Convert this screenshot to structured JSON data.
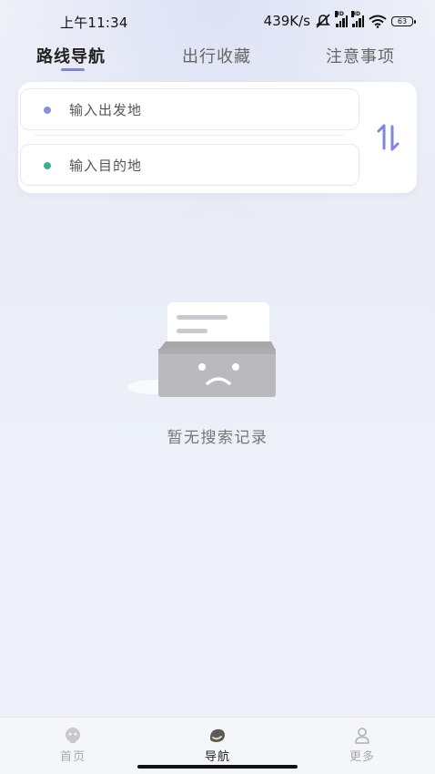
{
  "status_bar": {
    "time": "上午11:34",
    "network_speed": "439K/s",
    "signal_badge_1": "HD",
    "signal_badge_2": "HD",
    "battery": "63"
  },
  "tabs": [
    {
      "label": "路线导航",
      "active": true
    },
    {
      "label": "出行收藏",
      "active": false
    },
    {
      "label": "注意事项",
      "active": false
    }
  ],
  "route": {
    "origin_placeholder": "输入出发地",
    "destination_placeholder": "输入目的地",
    "origin_dot_color": "#8a8fd8",
    "destination_dot_color": "#3cae8f",
    "swap_icon": "swap-vertical-icon"
  },
  "empty_state": {
    "icon": "empty-box-icon",
    "text": "暂无搜索记录"
  },
  "bottom_nav": [
    {
      "label": "首页",
      "icon": "home-face-icon",
      "active": false
    },
    {
      "label": "导航",
      "icon": "navigation-icon",
      "active": true
    },
    {
      "label": "更多",
      "icon": "user-icon",
      "active": false
    }
  ],
  "colors": {
    "accent": "#7f86e0",
    "background": "#eceff8",
    "inactive_text": "#aaaaaa"
  }
}
